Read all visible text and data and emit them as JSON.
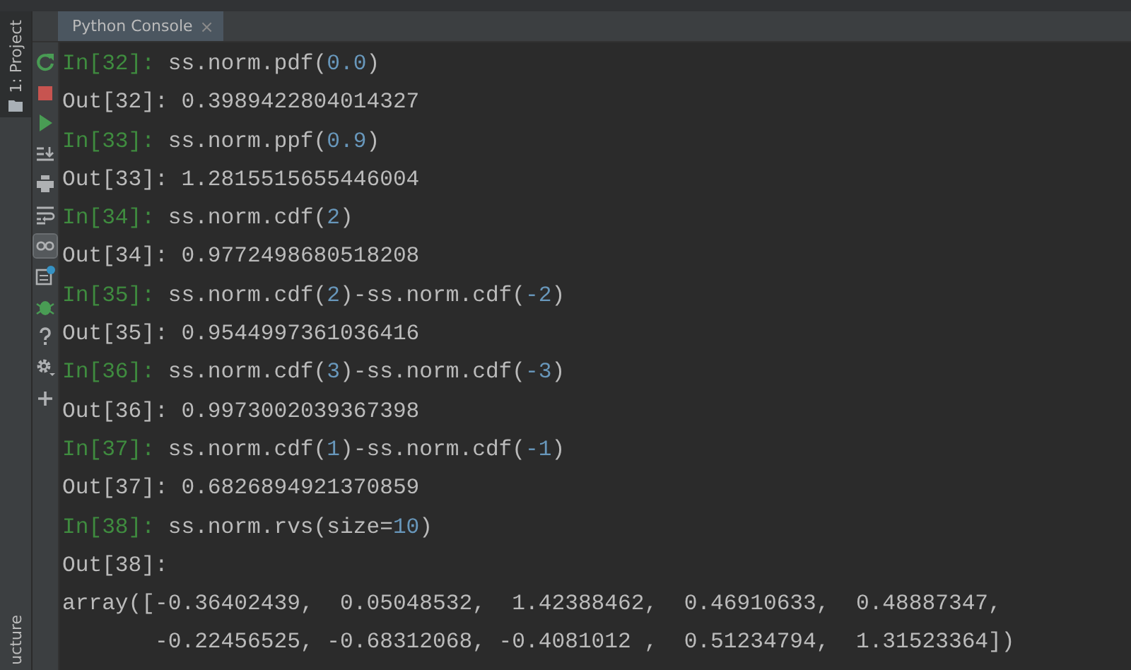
{
  "side_strip": {
    "top_label": "1: Project",
    "bottom_label": "ucture"
  },
  "tab": {
    "title": "Python Console",
    "close": "×"
  },
  "toolbar": [
    {
      "kind": "rerun",
      "toggled": false
    },
    {
      "kind": "stop",
      "toggled": false
    },
    {
      "kind": "run",
      "toggled": false
    },
    {
      "kind": "scroll-end",
      "toggled": false
    },
    {
      "kind": "print",
      "toggled": false
    },
    {
      "kind": "wrap",
      "toggled": false
    },
    {
      "kind": "variables",
      "toggled": true
    },
    {
      "kind": "history",
      "toggled": false
    },
    {
      "kind": "bug",
      "toggled": false
    },
    {
      "kind": "help",
      "toggled": false
    },
    {
      "kind": "gear",
      "toggled": false
    },
    {
      "kind": "plus",
      "toggled": false
    }
  ],
  "console": [
    {
      "kind": "input",
      "prompt": "In[32]:",
      "code": [
        {
          "kind": "text",
          "text": "ss.norm.pdf("
        },
        {
          "kind": "number",
          "text": "0.0"
        },
        {
          "kind": "text",
          "text": ")"
        }
      ]
    },
    {
      "kind": "output",
      "text": "Out[32]: 0.3989422804014327"
    },
    {
      "kind": "input",
      "prompt": "In[33]:",
      "code": [
        {
          "kind": "text",
          "text": "ss.norm.ppf("
        },
        {
          "kind": "number",
          "text": "0.9"
        },
        {
          "kind": "text",
          "text": ")"
        }
      ]
    },
    {
      "kind": "output",
      "text": "Out[33]: 1.2815515655446004"
    },
    {
      "kind": "input",
      "prompt": "In[34]:",
      "code": [
        {
          "kind": "text",
          "text": "ss.norm.cdf("
        },
        {
          "kind": "number",
          "text": "2"
        },
        {
          "kind": "text",
          "text": ")"
        }
      ]
    },
    {
      "kind": "output",
      "text": "Out[34]: 0.9772498680518208"
    },
    {
      "kind": "input",
      "prompt": "In[35]:",
      "code": [
        {
          "kind": "text",
          "text": "ss.norm.cdf("
        },
        {
          "kind": "number",
          "text": "2"
        },
        {
          "kind": "text",
          "text": ")-ss.norm.cdf("
        },
        {
          "kind": "number",
          "text": "-2"
        },
        {
          "kind": "text",
          "text": ")"
        }
      ]
    },
    {
      "kind": "output",
      "text": "Out[35]: 0.9544997361036416"
    },
    {
      "kind": "input",
      "prompt": "In[36]:",
      "code": [
        {
          "kind": "text",
          "text": "ss.norm.cdf("
        },
        {
          "kind": "number",
          "text": "3"
        },
        {
          "kind": "text",
          "text": ")-ss.norm.cdf("
        },
        {
          "kind": "number",
          "text": "-3"
        },
        {
          "kind": "text",
          "text": ")"
        }
      ]
    },
    {
      "kind": "output",
      "text": "Out[36]: 0.9973002039367398"
    },
    {
      "kind": "input",
      "prompt": "In[37]:",
      "code": [
        {
          "kind": "text",
          "text": "ss.norm.cdf("
        },
        {
          "kind": "number",
          "text": "1"
        },
        {
          "kind": "text",
          "text": ")-ss.norm.cdf("
        },
        {
          "kind": "number",
          "text": "-1"
        },
        {
          "kind": "text",
          "text": ")"
        }
      ]
    },
    {
      "kind": "output",
      "text": "Out[37]: 0.6826894921370859"
    },
    {
      "kind": "input",
      "prompt": "In[38]:",
      "code": [
        {
          "kind": "text",
          "text": "ss.norm.rvs(size="
        },
        {
          "kind": "number",
          "text": "10"
        },
        {
          "kind": "text",
          "text": ")"
        }
      ]
    },
    {
      "kind": "output",
      "text": "Out[38]:"
    },
    {
      "kind": "output",
      "text": "array([-0.36402439,  0.05048532,  1.42388462,  0.46910633,  0.48887347,"
    },
    {
      "kind": "output",
      "text": "       -0.22456525, -0.68312068, -0.4081012 ,  0.51234794,  1.31523364])"
    }
  ]
}
